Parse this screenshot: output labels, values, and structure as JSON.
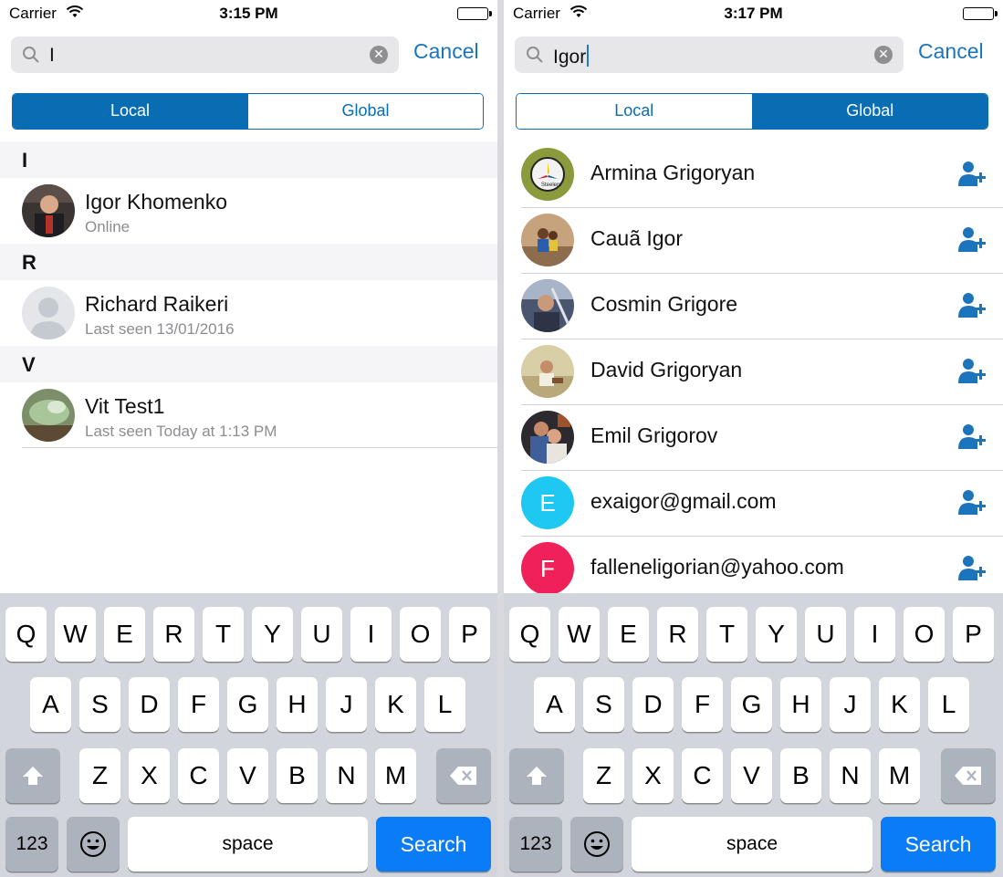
{
  "left": {
    "status": {
      "carrier": "Carrier",
      "time": "3:15 PM"
    },
    "search": {
      "query": "I",
      "cancel": "Cancel"
    },
    "segments": [
      {
        "label": "Local",
        "active": true
      },
      {
        "label": "Global",
        "active": false
      }
    ],
    "sections": [
      {
        "header": "I",
        "contacts": [
          {
            "name": "Igor Khomenko",
            "status": "Online",
            "avatar": "photo-man-dark"
          }
        ]
      },
      {
        "header": "R",
        "contacts": [
          {
            "name": "Richard Raikeri",
            "status": "Last seen 13/01/2016",
            "avatar": "placeholder-person"
          }
        ]
      },
      {
        "header": "V",
        "contacts": [
          {
            "name": "Vit Test1",
            "status": "Last seen Today at 1:13 PM",
            "avatar": "photo-green"
          }
        ]
      }
    ]
  },
  "right": {
    "status": {
      "carrier": "Carrier",
      "time": "3:17 PM"
    },
    "search": {
      "query": "Igor",
      "cancel": "Cancel"
    },
    "segments": [
      {
        "label": "Local",
        "active": false
      },
      {
        "label": "Global",
        "active": true
      }
    ],
    "results": [
      {
        "name": "Armina Grigoryan",
        "avatar": "logo-steelers"
      },
      {
        "name": "Cauã Igor",
        "avatar": "photo-kids"
      },
      {
        "name": "Cosmin Grigore",
        "avatar": "photo-man-car"
      },
      {
        "name": "David Grigoryan",
        "avatar": "photo-boy"
      },
      {
        "name": "Emil Grigorov",
        "avatar": "photo-couple"
      },
      {
        "name": "exaigor@gmail.com",
        "avatar_letter": "E",
        "avatar_color": "#1ec8f0"
      },
      {
        "name": "falleneligorian@yahoo.com",
        "avatar_letter": "F",
        "avatar_color": "#f0215a"
      }
    ]
  },
  "keyboard": {
    "row1": [
      "Q",
      "W",
      "E",
      "R",
      "T",
      "Y",
      "U",
      "I",
      "O",
      "P"
    ],
    "row2": [
      "A",
      "S",
      "D",
      "F",
      "G",
      "H",
      "J",
      "K",
      "L"
    ],
    "row3": [
      "Z",
      "X",
      "C",
      "V",
      "B",
      "N",
      "M"
    ],
    "numbers": "123",
    "space": "space",
    "search": "Search"
  },
  "colors": {
    "accent": "#0a6cb2",
    "link": "#1c75bc",
    "search_key": "#0b7cf7"
  }
}
